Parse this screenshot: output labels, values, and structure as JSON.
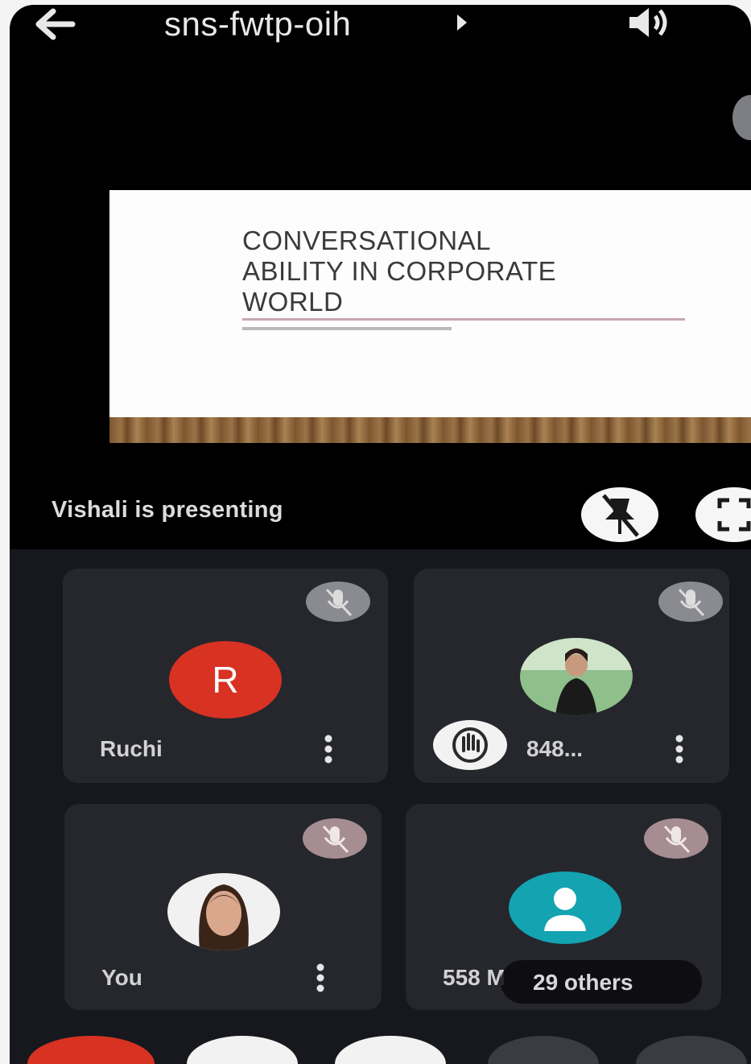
{
  "header": {
    "meeting_code": "sns-fwtp-oih"
  },
  "slide": {
    "title_line1": "CONVERSATIONAL",
    "title_line2": "ABILITY IN CORPORATE",
    "title_line3": "WORLD"
  },
  "presenting": {
    "text": "Vishali is presenting"
  },
  "tiles": [
    {
      "name": "Ruchi",
      "avatar_letter": "R",
      "avatar_color": "#d83222"
    },
    {
      "name": "848..."
    },
    {
      "name": "You"
    },
    {
      "name": "558 M",
      "others_label": "29 others"
    }
  ],
  "colors": {
    "background": "#000000",
    "tile": "#25272d",
    "end_call": "#d83222",
    "generic_avatar": "#13a3b1"
  },
  "icons": [
    "back-arrow-icon",
    "chevron-right-icon",
    "speaker-icon",
    "unpin-icon",
    "fullscreen-icon",
    "mic-off-icon",
    "more-vert-icon",
    "raised-hand-icon",
    "person-icon"
  ]
}
